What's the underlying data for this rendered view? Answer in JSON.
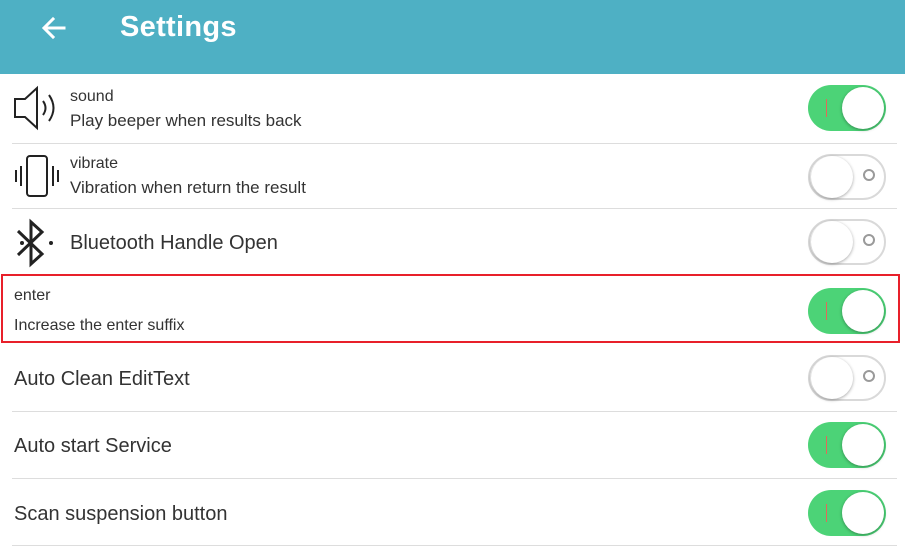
{
  "appbar": {
    "title": "Settings",
    "back_icon": "arrow-left-icon",
    "color": "#4eb0c4"
  },
  "settings": [
    {
      "title": "sound",
      "subtitle": "Play beeper when results back",
      "icon": "speaker-icon",
      "enabled": true
    },
    {
      "title": "vibrate",
      "subtitle": "Vibration when return the result",
      "icon": "vibrate-icon",
      "enabled": false
    },
    {
      "title": "Bluetooth Handle Open",
      "icon": "bluetooth-icon",
      "enabled": false
    },
    {
      "title": "enter",
      "subtitle": "Increase the enter suffix",
      "enabled": true,
      "highlighted": true
    },
    {
      "title": "Auto Clean EditText",
      "enabled": false
    },
    {
      "title": "Auto start Service",
      "enabled": true
    },
    {
      "title": "Scan suspension button",
      "enabled": true
    }
  ],
  "colors": {
    "toggle_on": "#4cd377",
    "highlight_border": "#e8202a"
  }
}
